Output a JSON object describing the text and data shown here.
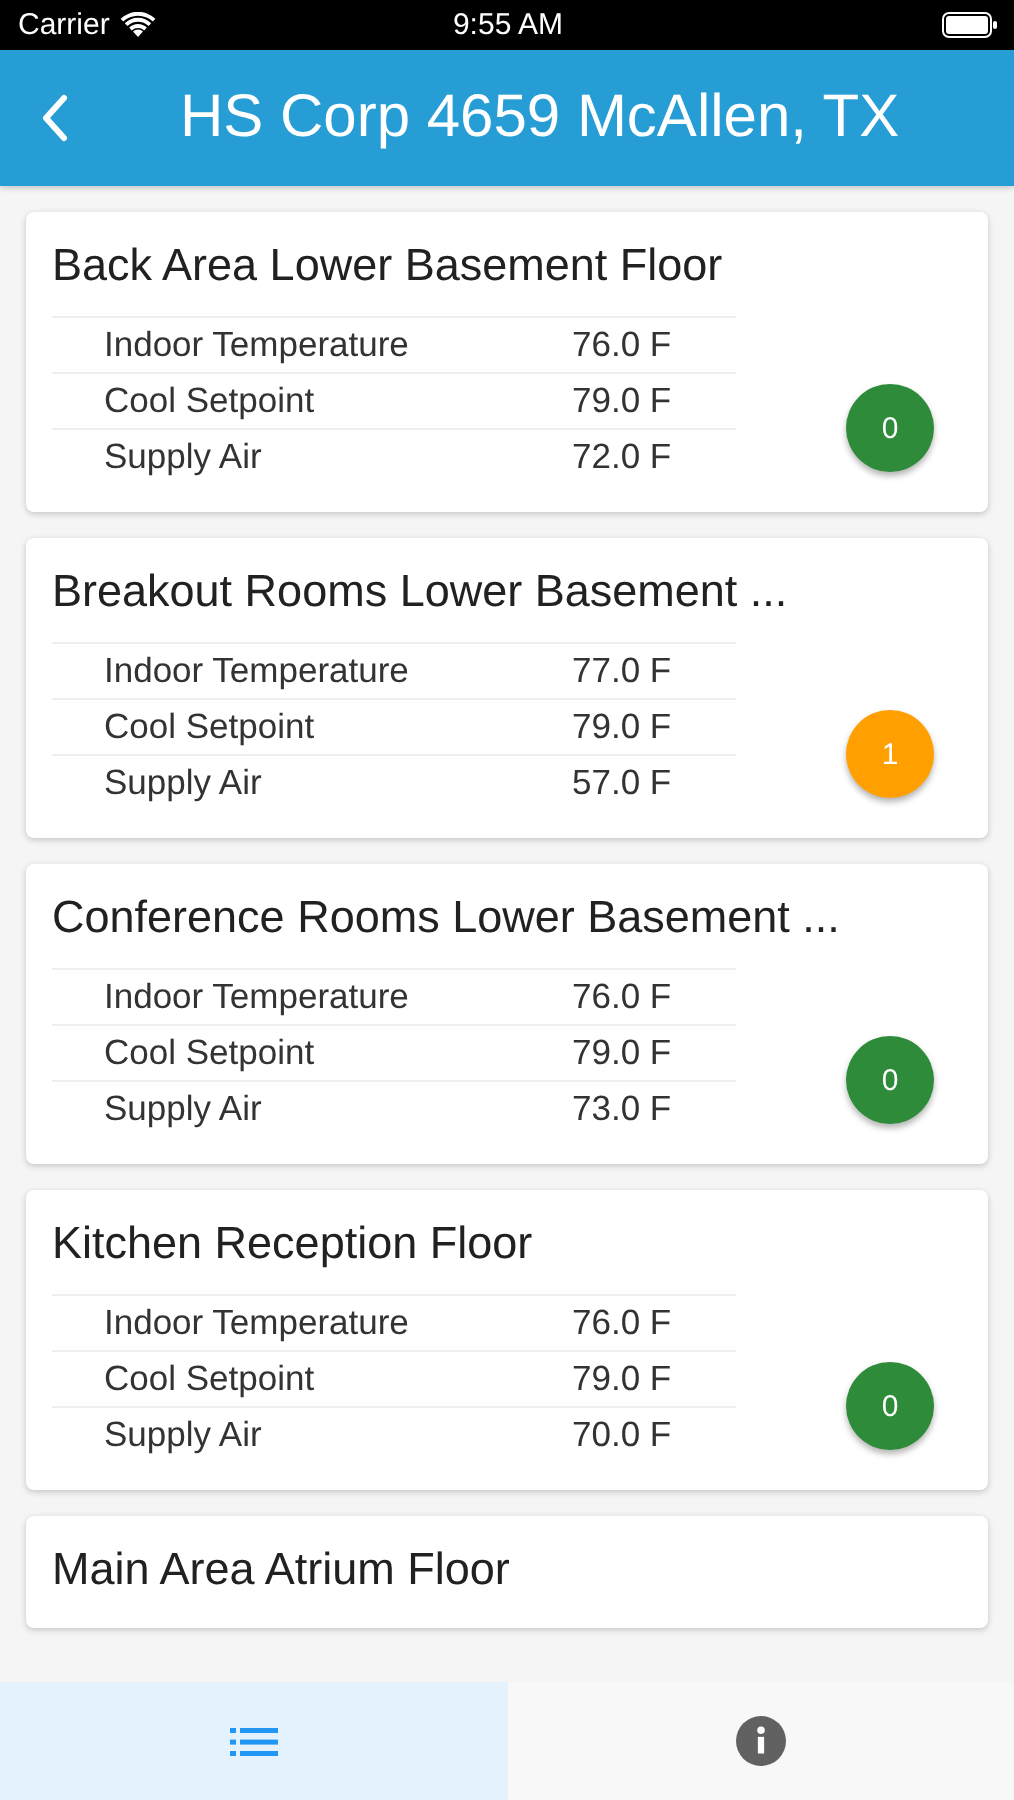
{
  "status_bar": {
    "carrier": "Carrier",
    "time": "9:55 AM"
  },
  "header": {
    "title": "HS Corp 4659 McAllen, TX"
  },
  "zones": [
    {
      "name": "Back Area Lower Basement Floor",
      "readings": [
        {
          "label": "Indoor Temperature",
          "value": "76.0 F"
        },
        {
          "label": "Cool Setpoint",
          "value": "79.0 F"
        },
        {
          "label": "Supply Air",
          "value": "72.0 F"
        }
      ],
      "badge": {
        "count": "0",
        "color": "#2e8b3a"
      }
    },
    {
      "name": "Breakout Rooms Lower Basement ...",
      "readings": [
        {
          "label": "Indoor Temperature",
          "value": "77.0 F"
        },
        {
          "label": "Cool Setpoint",
          "value": "79.0 F"
        },
        {
          "label": "Supply Air",
          "value": "57.0 F"
        }
      ],
      "badge": {
        "count": "1",
        "color": "#ffa000"
      }
    },
    {
      "name": "Conference Rooms Lower Basement ...",
      "readings": [
        {
          "label": "Indoor Temperature",
          "value": "76.0 F"
        },
        {
          "label": "Cool Setpoint",
          "value": "79.0 F"
        },
        {
          "label": "Supply Air",
          "value": "73.0 F"
        }
      ],
      "badge": {
        "count": "0",
        "color": "#2e8b3a"
      }
    },
    {
      "name": "Kitchen Reception Floor",
      "readings": [
        {
          "label": "Indoor Temperature",
          "value": "76.0 F"
        },
        {
          "label": "Cool Setpoint",
          "value": "79.0 F"
        },
        {
          "label": "Supply Air",
          "value": "70.0 F"
        }
      ],
      "badge": {
        "count": "0",
        "color": "#2e8b3a"
      }
    },
    {
      "name": "Main Area Atrium Floor"
    }
  ],
  "tabs": [
    {
      "kind": "list",
      "selected": true
    },
    {
      "kind": "info",
      "selected": false
    }
  ]
}
